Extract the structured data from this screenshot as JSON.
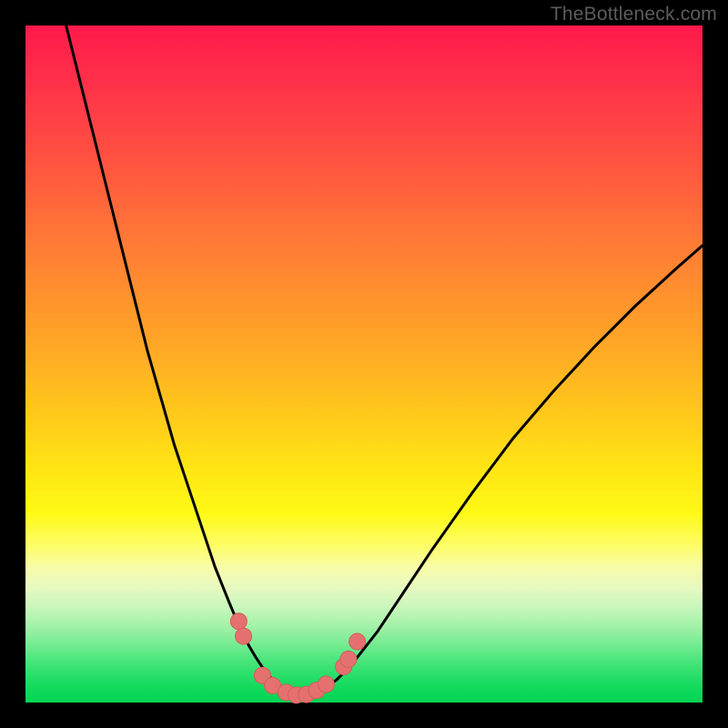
{
  "watermark": "TheBottleneck.com",
  "colors": {
    "frame": "#000000",
    "curve_stroke": "#000000",
    "marker_fill": "#e4716f",
    "marker_stroke": "#d35d5b"
  },
  "chart_data": {
    "type": "line",
    "title": "",
    "xlabel": "",
    "ylabel": "",
    "xlim": [
      0,
      100
    ],
    "ylim": [
      0,
      100
    ],
    "grid": false,
    "legend": false,
    "series": [
      {
        "name": "bottleneck-curve",
        "x": [
          6,
          8,
          10,
          12,
          14,
          16,
          18,
          20,
          22,
          24,
          26,
          28,
          30,
          31,
          32,
          33,
          34,
          35,
          36,
          37,
          38,
          39,
          40,
          41,
          42,
          44,
          46,
          48,
          52,
          56,
          60,
          66,
          72,
          78,
          84,
          90,
          96,
          100
        ],
        "y": [
          100,
          92,
          84,
          76,
          68,
          60,
          52,
          45,
          38,
          32,
          26,
          20,
          15,
          12.6,
          10.4,
          8.4,
          6.7,
          5.2,
          3.9,
          2.9,
          2.1,
          1.5,
          1.1,
          1.0,
          1.1,
          1.9,
          3.4,
          5.4,
          10.5,
          16.5,
          22.5,
          31,
          39,
          46,
          52.5,
          58.5,
          64,
          67.5
        ]
      }
    ],
    "markers": [
      {
        "x": 31.5,
        "y": 12.0
      },
      {
        "x": 32.2,
        "y": 9.8
      },
      {
        "x": 35.0,
        "y": 4.0
      },
      {
        "x": 36.5,
        "y": 2.5
      },
      {
        "x": 38.5,
        "y": 1.5
      },
      {
        "x": 40.0,
        "y": 1.1
      },
      {
        "x": 41.5,
        "y": 1.2
      },
      {
        "x": 43.0,
        "y": 1.8
      },
      {
        "x": 44.4,
        "y": 2.7
      },
      {
        "x": 47.0,
        "y": 5.3
      },
      {
        "x": 47.7,
        "y": 6.4
      },
      {
        "x": 49.0,
        "y": 9.0
      }
    ]
  }
}
